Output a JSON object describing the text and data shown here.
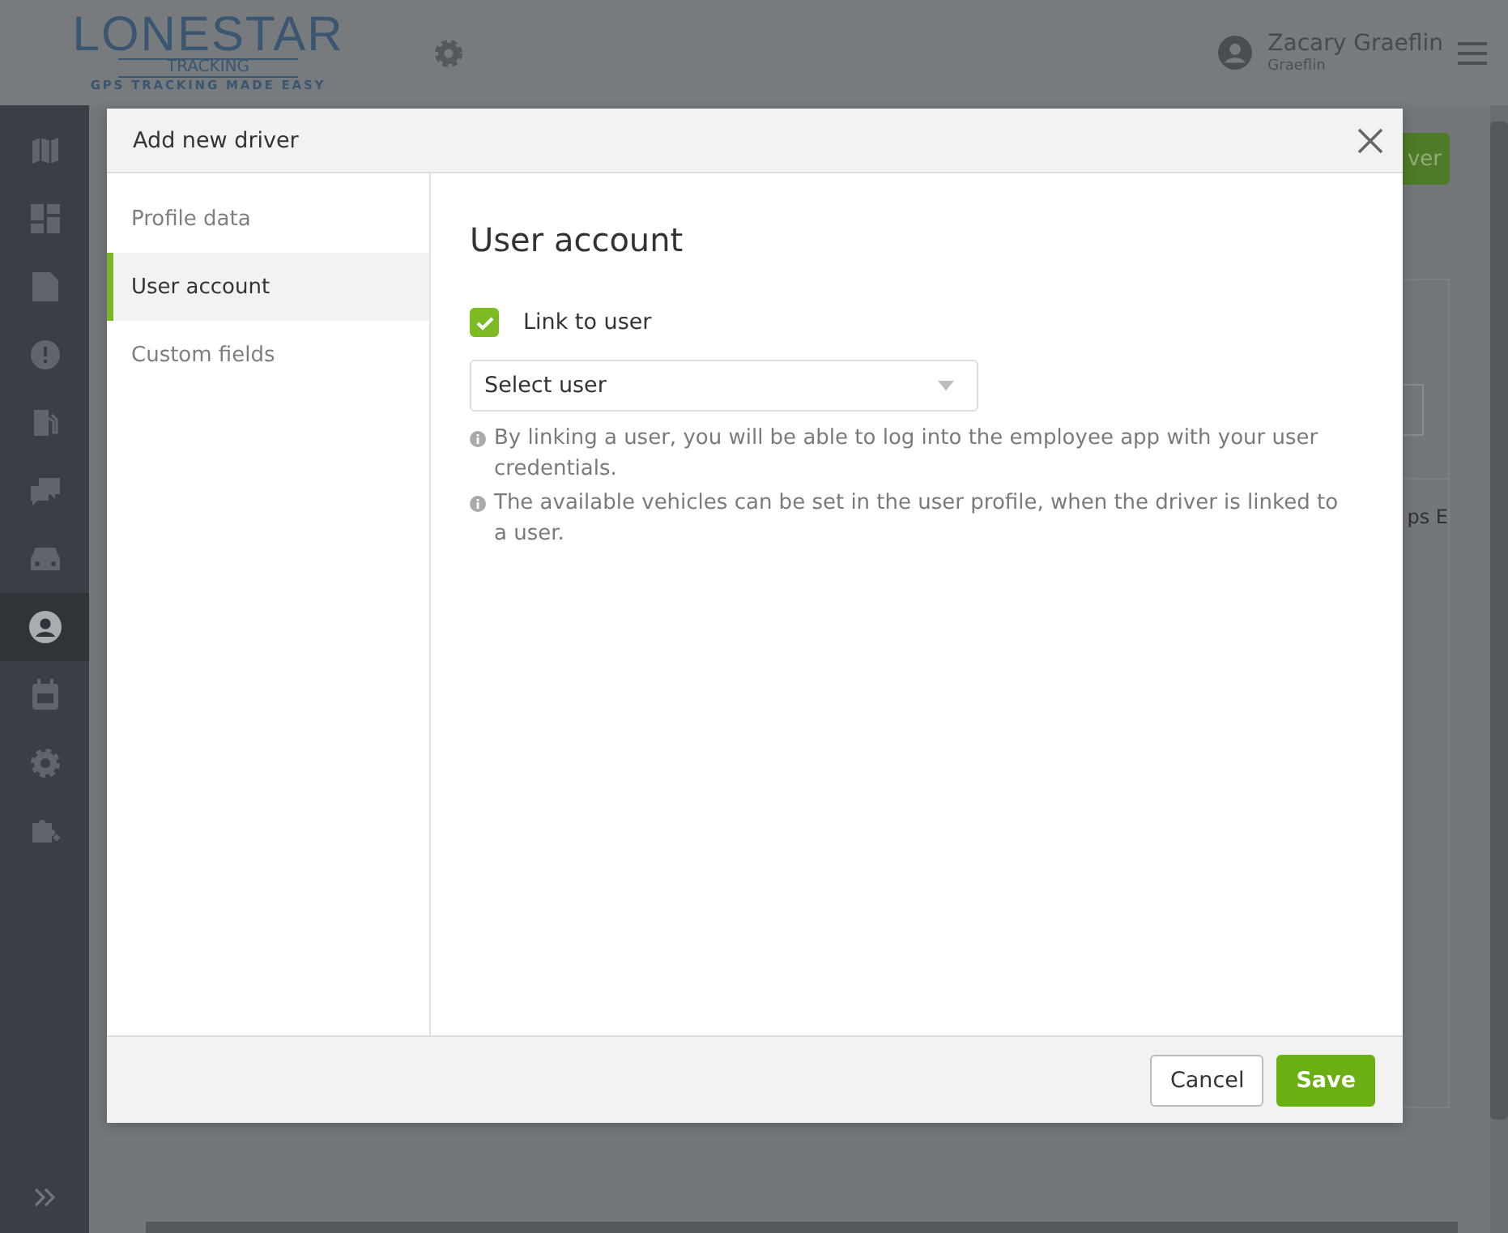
{
  "header": {
    "logo": {
      "name": "LONESTAR",
      "sub": "TRACKING",
      "tagline": "GPS TRACKING MADE EASY"
    },
    "user": {
      "name": "Zacary Graeflin",
      "account": "Graeflin"
    }
  },
  "sidebar": {
    "items": [
      {
        "selected": false
      },
      {
        "selected": false
      },
      {
        "selected": false
      },
      {
        "selected": false
      },
      {
        "selected": false
      },
      {
        "selected": false
      },
      {
        "selected": false
      },
      {
        "selected": true
      },
      {
        "selected": false
      },
      {
        "selected": false
      },
      {
        "selected": false
      }
    ]
  },
  "background_page": {
    "button": "ver",
    "cell_text": "ps E"
  },
  "modal": {
    "title": "Add new driver",
    "nav": [
      {
        "label": "Profile data",
        "selected": false
      },
      {
        "label": "User account",
        "selected": true
      },
      {
        "label": "Custom fields",
        "selected": false
      }
    ],
    "section_title": "User account",
    "link_to_user": {
      "label": "Link to user",
      "checked": true
    },
    "user_select": {
      "placeholder": "Select user"
    },
    "notes": [
      "By linking a user, you will be able to log into the employee app with your user credentials.",
      "The available vehicles can be set in the user profile, when the driver is linked to a user."
    ],
    "buttons": [
      {
        "label": "Cancel",
        "kind": "secondary"
      },
      {
        "label": "Save",
        "kind": "primary"
      }
    ]
  }
}
